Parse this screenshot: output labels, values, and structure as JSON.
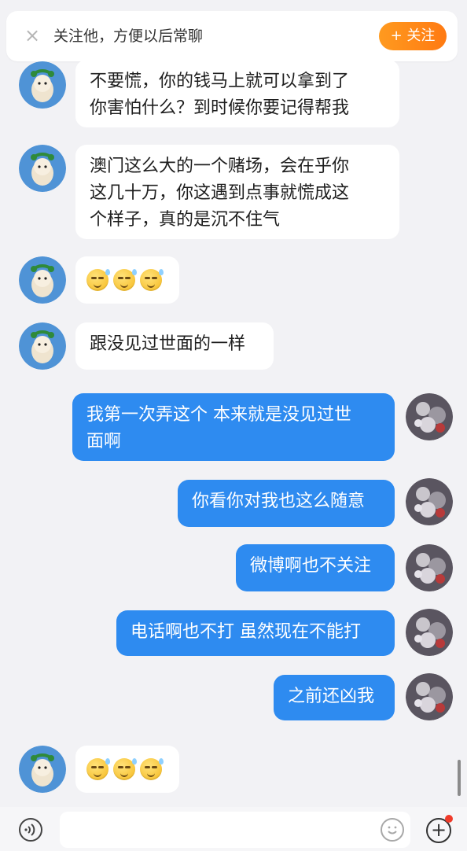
{
  "follow_bar": {
    "close_icon": "close-icon",
    "text": "关注他，方便以后常聊",
    "button_label": "+ 关注",
    "button_color": "#ff8a18"
  },
  "colors": {
    "incoming_bubble": "#ffffff",
    "outgoing_bubble": "#2e8bf0",
    "background": "#f2f2f5"
  },
  "messages": [
    {
      "side": "in",
      "lines": [
        "不要慌，你的钱马上就可以拿到了",
        "你害怕什么？到时候你要记得帮我"
      ]
    },
    {
      "side": "in",
      "lines": [
        "澳门这么大的一个赌场，会在乎你",
        "这几十万，你这遇到点事就慌成这",
        "个样子，真的是沉不住气"
      ]
    },
    {
      "side": "in",
      "emoji": "sweat-smile-emoji x3"
    },
    {
      "side": "in",
      "lines": [
        "跟没见过世面的一样"
      ]
    },
    {
      "side": "out",
      "lines": [
        "我第一次弄这个 本来就是没见过世",
        "面啊"
      ]
    },
    {
      "side": "out",
      "lines": [
        "你看你对我也这么随意"
      ]
    },
    {
      "side": "out",
      "lines": [
        "微博啊也不关注"
      ]
    },
    {
      "side": "out",
      "lines": [
        "电话啊也不打 虽然现在不能打"
      ]
    },
    {
      "side": "out",
      "lines": [
        "之前还凶我"
      ]
    },
    {
      "side": "in",
      "emoji": "sweat-smile-emoji x3"
    }
  ],
  "input_bar": {
    "voice_icon": "voice-icon",
    "emoji_icon": "emoji-icon",
    "plus_icon": "plus-icon"
  }
}
